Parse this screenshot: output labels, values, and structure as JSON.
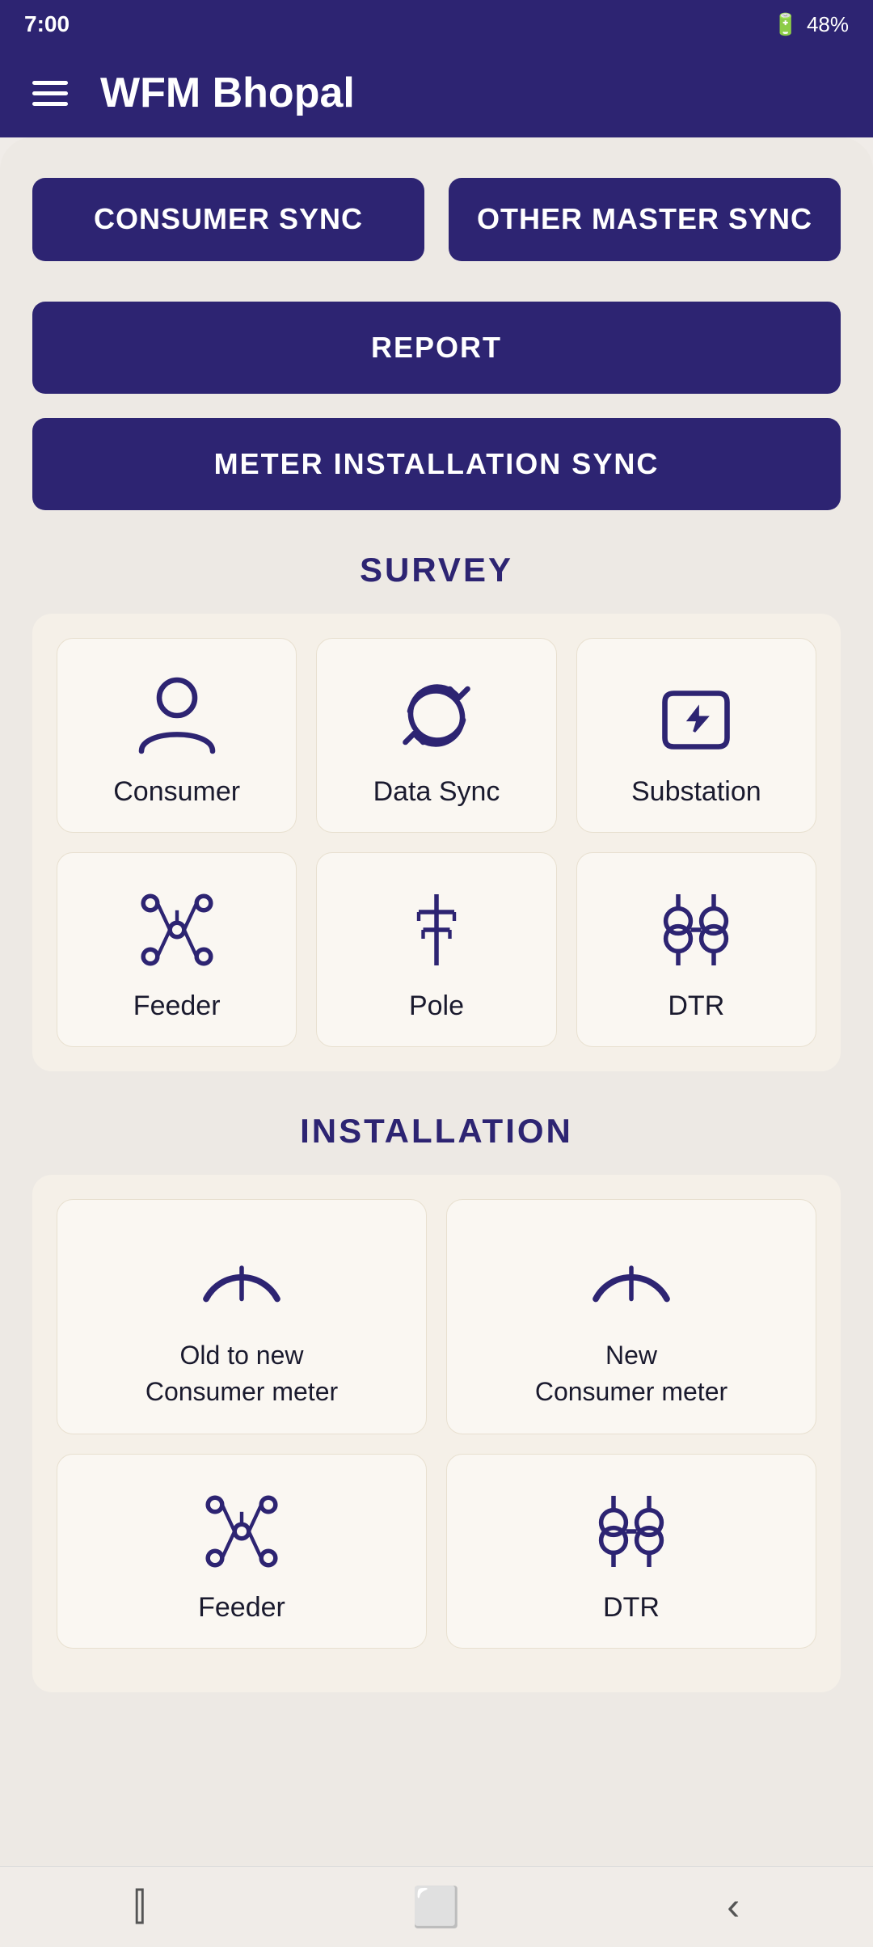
{
  "status_bar": {
    "time": "7:00",
    "battery": "48%"
  },
  "header": {
    "title": "WFM Bhopal",
    "menu_icon": "hamburger"
  },
  "buttons": {
    "consumer_sync": "CONSUMER SYNC",
    "other_master_sync": "OTHER MASTER SYNC",
    "report": "REPORT",
    "meter_installation_sync": "METER INSTALLATION SYNC"
  },
  "survey": {
    "section_title": "SURVEY",
    "items": [
      {
        "id": "consumer",
        "label": "Consumer",
        "icon": "person"
      },
      {
        "id": "data-sync",
        "label": "Data Sync",
        "icon": "sync"
      },
      {
        "id": "substation",
        "label": "Substation",
        "icon": "lightning-home"
      },
      {
        "id": "feeder",
        "label": "Feeder",
        "icon": "feeder"
      },
      {
        "id": "pole",
        "label": "Pole",
        "icon": "pole"
      },
      {
        "id": "dtr",
        "label": "DTR",
        "icon": "transformer"
      }
    ]
  },
  "installation": {
    "section_title": "INSTALLATION",
    "items": [
      {
        "id": "old-to-new",
        "label": "Old to new\nConsumer meter",
        "icon": "meter"
      },
      {
        "id": "new-consumer",
        "label": "New\nConsumer meter",
        "icon": "meter"
      },
      {
        "id": "install-feeder",
        "label": "Feeder",
        "icon": "feeder"
      },
      {
        "id": "install-dtr",
        "label": "DTR",
        "icon": "transformer"
      }
    ]
  },
  "bottom_nav": {
    "items": [
      "recent-apps",
      "home",
      "back"
    ]
  }
}
